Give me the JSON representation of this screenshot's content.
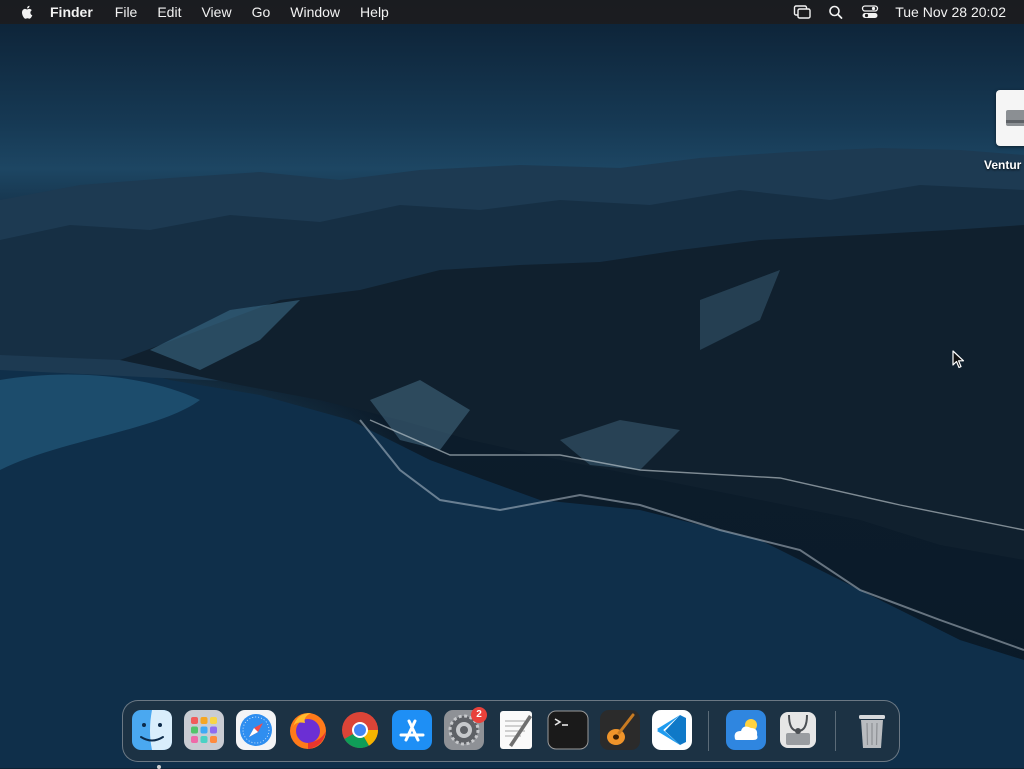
{
  "menubar": {
    "app_name": "Finder",
    "items": [
      "File",
      "Edit",
      "View",
      "Go",
      "Window",
      "Help"
    ],
    "clock": "Tue Nov 28  20:02",
    "status_icons": [
      "screen-mirroring-icon",
      "spotlight-search-icon",
      "control-center-icon"
    ]
  },
  "desktop": {
    "icons": [
      {
        "label": "Ventur",
        "icon": "external-disk-icon"
      }
    ]
  },
  "dock": {
    "apps": [
      {
        "name": "Finder",
        "icon": "finder-icon",
        "running": true
      },
      {
        "name": "Launchpad",
        "icon": "launchpad-icon"
      },
      {
        "name": "Safari",
        "icon": "safari-icon"
      },
      {
        "name": "Firefox",
        "icon": "firefox-icon"
      },
      {
        "name": "Google Chrome",
        "icon": "chrome-icon"
      },
      {
        "name": "App Store",
        "icon": "app-store-icon"
      },
      {
        "name": "System Settings",
        "icon": "system-settings-icon",
        "badge": "2"
      },
      {
        "name": "TextEdit",
        "icon": "textedit-icon"
      },
      {
        "name": "Terminal",
        "icon": "terminal-icon"
      },
      {
        "name": "GarageBand",
        "icon": "garageband-icon"
      },
      {
        "name": "Visual Studio Code",
        "icon": "vscode-icon"
      },
      {
        "name": "Weather",
        "icon": "weather-icon"
      },
      {
        "name": "Disk Utility",
        "icon": "disk-utility-icon"
      },
      {
        "name": "Trash",
        "icon": "trash-icon"
      }
    ]
  },
  "colors": {
    "menubar_bg": "#1c1c1e",
    "badge": "#e8413b",
    "wallpaper_sky": "#163954",
    "wallpaper_sea": "#0f3350"
  }
}
